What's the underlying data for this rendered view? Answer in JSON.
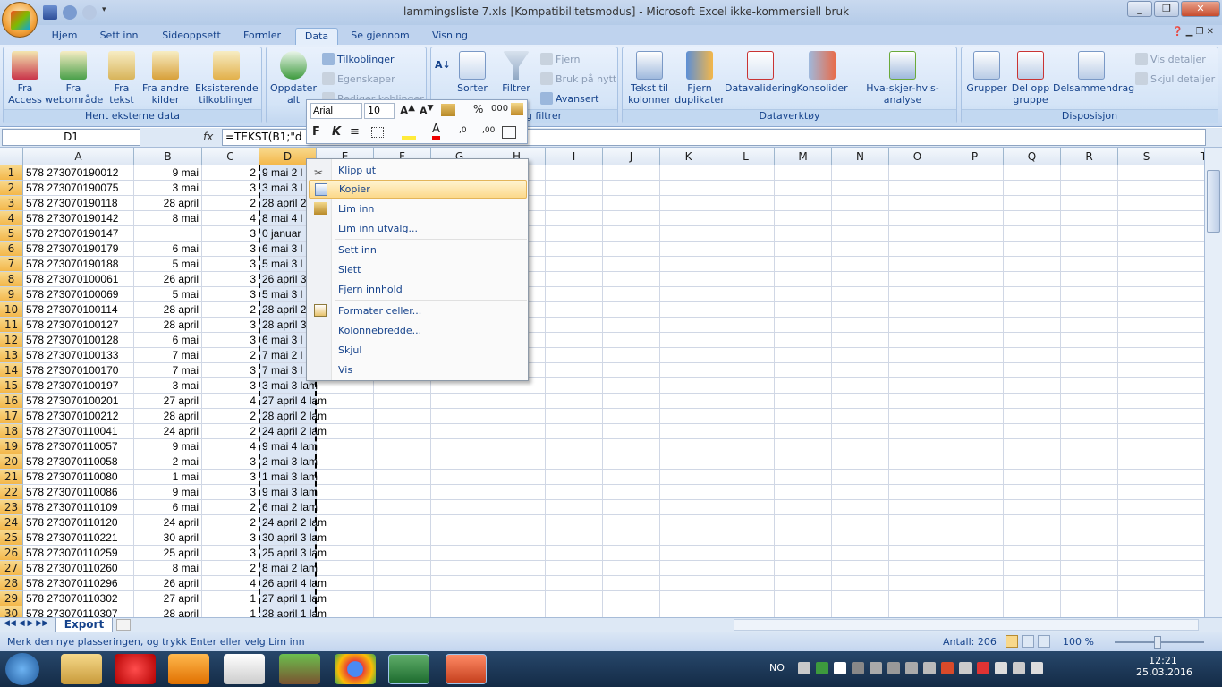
{
  "window": {
    "title": "lammingsliste 7.xls  [Kompatibilitetsmodus] - Microsoft Excel ikke-kommersiell bruk"
  },
  "tabs": [
    "Hjem",
    "Sett inn",
    "Sideoppsett",
    "Formler",
    "Data",
    "Se gjennom",
    "Visning"
  ],
  "active_tab": "Data",
  "ribbon": {
    "hent": {
      "label": "Hent eksterne data",
      "fra_access": "Fra Access",
      "fra_web": "Fra webområde",
      "fra_tekst": "Fra tekst",
      "fra_andre": "Fra andre kilder",
      "eksisterende": "Eksisterende tilkoblinger"
    },
    "tilkoblinger": {
      "oppdater": "Oppdater alt",
      "tilkoblinger": "Tilkoblinger",
      "egenskaper": "Egenskaper",
      "rediger": "Rediger koblinger"
    },
    "sort": {
      "label": "Sorter og filtrer",
      "sorter": "Sorter",
      "filtrer": "Filtrer",
      "fjern": "Fjern",
      "bruk": "Bruk på nytt",
      "avansert": "Avansert"
    },
    "dataverktoy": {
      "label": "Dataverktøy",
      "tekst_til": "Tekst til kolonner",
      "fjern_dup": "Fjern duplikater",
      "datavalidering": "Datavalidering",
      "konsolider": "Konsolider",
      "hva_skjer": "Hva-skjer-hvis-analyse"
    },
    "disposisjon": {
      "label": "Disposisjon",
      "grupper": "Grupper",
      "del_opp": "Del opp gruppe",
      "delsammendrag": "Delsammendrag",
      "vis": "Vis detaljer",
      "skjul": "Skjul detaljer"
    }
  },
  "formula": {
    "namebox": "D1",
    "fx": "fx",
    "content": "=TEKST(B1;\"d m"
  },
  "columns": [
    "A",
    "B",
    "C",
    "D",
    "E",
    "F",
    "G",
    "H",
    "I",
    "J",
    "K",
    "L",
    "M",
    "N",
    "O",
    "P",
    "Q",
    "R",
    "S",
    "T"
  ],
  "rows": [
    {
      "a": "578 273070190012",
      "b": "9 mai",
      "c": "2",
      "d": "9 mai 2 l"
    },
    {
      "a": "578 273070190075",
      "b": "3 mai",
      "c": "3",
      "d": "3 mai 3 l"
    },
    {
      "a": "578 273070190118",
      "b": "28 april",
      "c": "2",
      "d": "28 april 2"
    },
    {
      "a": "578 273070190142",
      "b": "8 mai",
      "c": "4",
      "d": "8 mai 4 l"
    },
    {
      "a": "578 273070190147",
      "b": "",
      "c": "3",
      "d": "0 januar"
    },
    {
      "a": "578 273070190179",
      "b": "6 mai",
      "c": "3",
      "d": "6 mai 3 l"
    },
    {
      "a": "578 273070190188",
      "b": "5 mai",
      "c": "3",
      "d": "5 mai 3 l"
    },
    {
      "a": "578 273070100061",
      "b": "26 april",
      "c": "3",
      "d": "26 april 3"
    },
    {
      "a": "578 273070100069",
      "b": "5 mai",
      "c": "3",
      "d": "5 mai 3 l"
    },
    {
      "a": "578 273070100114",
      "b": "28 april",
      "c": "2",
      "d": "28 april 2"
    },
    {
      "a": "578 273070100127",
      "b": "28 april",
      "c": "3",
      "d": "28 april 3"
    },
    {
      "a": "578 273070100128",
      "b": "6 mai",
      "c": "3",
      "d": "6 mai 3 l"
    },
    {
      "a": "578 273070100133",
      "b": "7 mai",
      "c": "2",
      "d": "7 mai 2 l"
    },
    {
      "a": "578 273070100170",
      "b": "7 mai",
      "c": "3",
      "d": "7 mai 3 l"
    },
    {
      "a": "578 273070100197",
      "b": "3 mai",
      "c": "3",
      "d": "3 mai 3 lam"
    },
    {
      "a": "578 273070100201",
      "b": "27 april",
      "c": "4",
      "d": "27 april 4 lam"
    },
    {
      "a": "578 273070100212",
      "b": "28 april",
      "c": "2",
      "d": "28 april 2 lam"
    },
    {
      "a": "578 273070110041",
      "b": "24 april",
      "c": "2",
      "d": "24 april 2 lam"
    },
    {
      "a": "578 273070110057",
      "b": "9 mai",
      "c": "4",
      "d": "9 mai 4 lam"
    },
    {
      "a": "578 273070110058",
      "b": "2 mai",
      "c": "3",
      "d": "2 mai 3 lam"
    },
    {
      "a": "578 273070110080",
      "b": "1 mai",
      "c": "3",
      "d": "1 mai 3 lam"
    },
    {
      "a": "578 273070110086",
      "b": "9 mai",
      "c": "3",
      "d": "9 mai 3 lam"
    },
    {
      "a": "578 273070110109",
      "b": "6 mai",
      "c": "2",
      "d": "6 mai 2 lam"
    },
    {
      "a": "578 273070110120",
      "b": "24 april",
      "c": "2",
      "d": "24 april 2 lam"
    },
    {
      "a": "578 273070110221",
      "b": "30 april",
      "c": "3",
      "d": "30 april 3 lam"
    },
    {
      "a": "578 273070110259",
      "b": "25 april",
      "c": "3",
      "d": "25 april 3 lam"
    },
    {
      "a": "578 273070110260",
      "b": "8 mai",
      "c": "2",
      "d": "8 mai 2 lam"
    },
    {
      "a": "578 273070110296",
      "b": "26 april",
      "c": "4",
      "d": "26 april 4 lam"
    },
    {
      "a": "578 273070110302",
      "b": "27 april",
      "c": "1",
      "d": "27 april 1 lam"
    },
    {
      "a": "578 273070110307",
      "b": "28 april",
      "c": "1",
      "d": "28 april 1 lam"
    }
  ],
  "mini_toolbar": {
    "font": "Arial",
    "size": "10"
  },
  "context_menu": [
    "Klipp ut",
    "Kopier",
    "Lim inn",
    "Lim inn utvalg...",
    "Sett inn",
    "Slett",
    "Fjern innhold",
    "Formater celler...",
    "Kolonnebredde...",
    "Skjul",
    "Vis"
  ],
  "sheet_tab": "Export",
  "status": {
    "message": "Merk den nye plasseringen, og trykk Enter eller velg Lim inn",
    "count": "Antall: 206",
    "zoom": "100 %"
  },
  "taskbar": {
    "lang": "NO",
    "time": "12:21",
    "date": "25.03.2016"
  },
  "colors": {
    "accent": "#15428b",
    "ribbon": "#d1e1f5",
    "selection": "#f3b74a"
  }
}
